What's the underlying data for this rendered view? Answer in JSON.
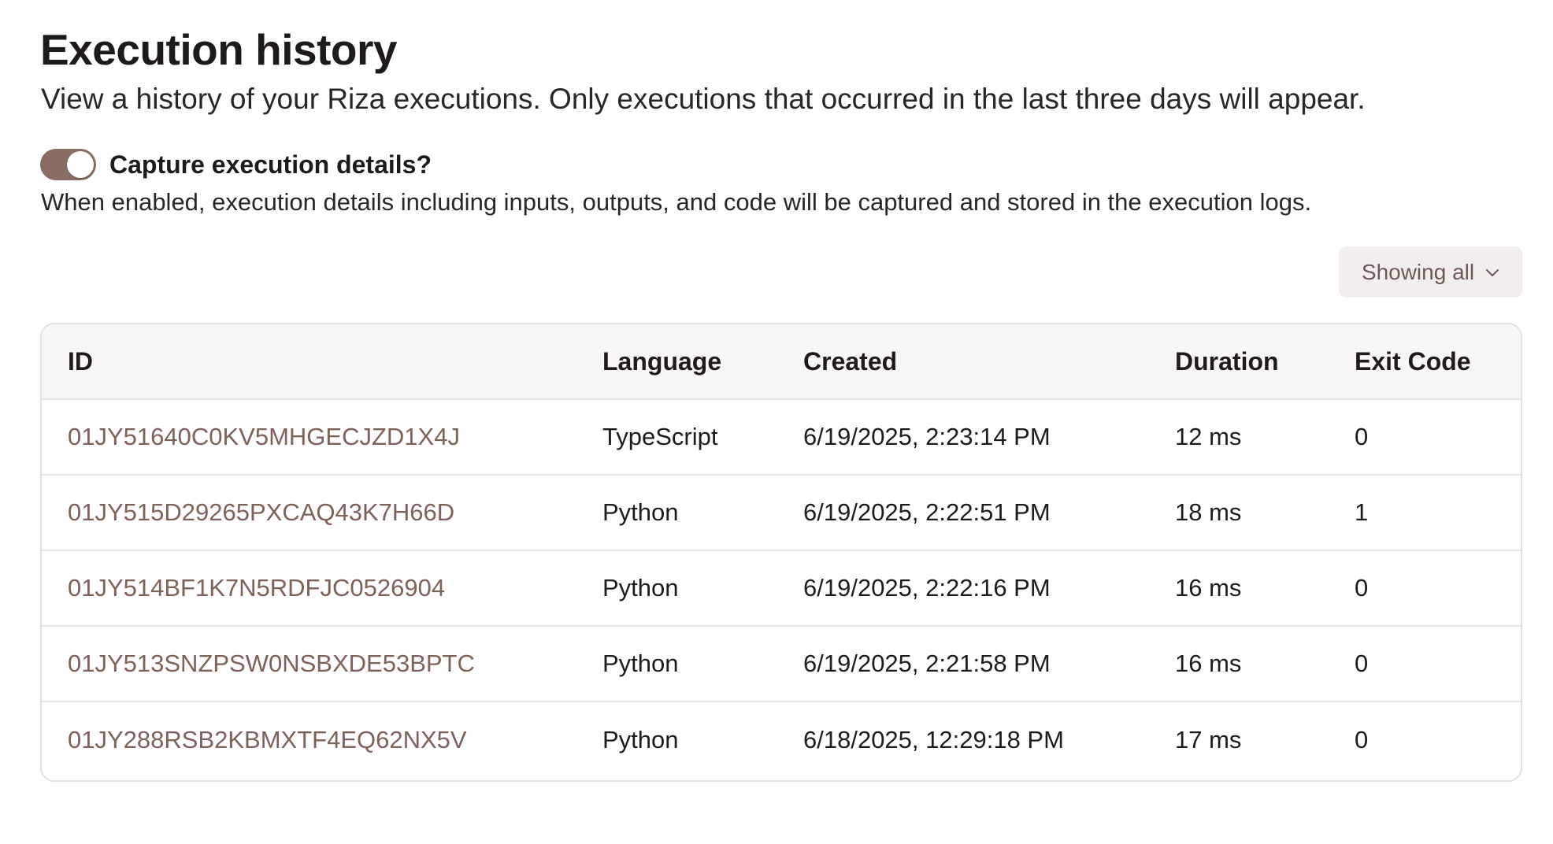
{
  "header": {
    "title": "Execution history",
    "subtitle": "View a history of your Riza executions. Only executions that occurred in the last three days will appear."
  },
  "capture": {
    "label": "Capture execution details?",
    "enabled": true,
    "description": "When enabled, execution details including inputs, outputs, and code will be captured and stored in the execution logs."
  },
  "filter": {
    "label": "Showing all",
    "icon": "chevron-down-icon"
  },
  "table": {
    "columns": {
      "id": "ID",
      "language": "Language",
      "created": "Created",
      "duration": "Duration",
      "exit_code": "Exit Code"
    },
    "rows": [
      {
        "id": "01JY51640C0KV5MHGECJZD1X4J",
        "language": "TypeScript",
        "created": "6/19/2025, 2:23:14 PM",
        "duration": "12 ms",
        "exit_code": "0"
      },
      {
        "id": "01JY515D29265PXCAQ43K7H66D",
        "language": "Python",
        "created": "6/19/2025, 2:22:51 PM",
        "duration": "18 ms",
        "exit_code": "1"
      },
      {
        "id": "01JY514BF1K7N5RDFJC0526904",
        "language": "Python",
        "created": "6/19/2025, 2:22:16 PM",
        "duration": "16 ms",
        "exit_code": "0"
      },
      {
        "id": "01JY513SNZPSW0NSBXDE53BPTC",
        "language": "Python",
        "created": "6/19/2025, 2:21:58 PM",
        "duration": "16 ms",
        "exit_code": "0"
      },
      {
        "id": "01JY288RSB2KBMXTF4EQ62NX5V",
        "language": "Python",
        "created": "6/18/2025, 12:29:18 PM",
        "duration": "17 ms",
        "exit_code": "0"
      }
    ]
  },
  "colors": {
    "accent": "#8b6e63",
    "link": "#7d6258",
    "button_bg": "#f2eeeb",
    "border": "#e4e1df",
    "header_bg": "#f8f7f6"
  }
}
